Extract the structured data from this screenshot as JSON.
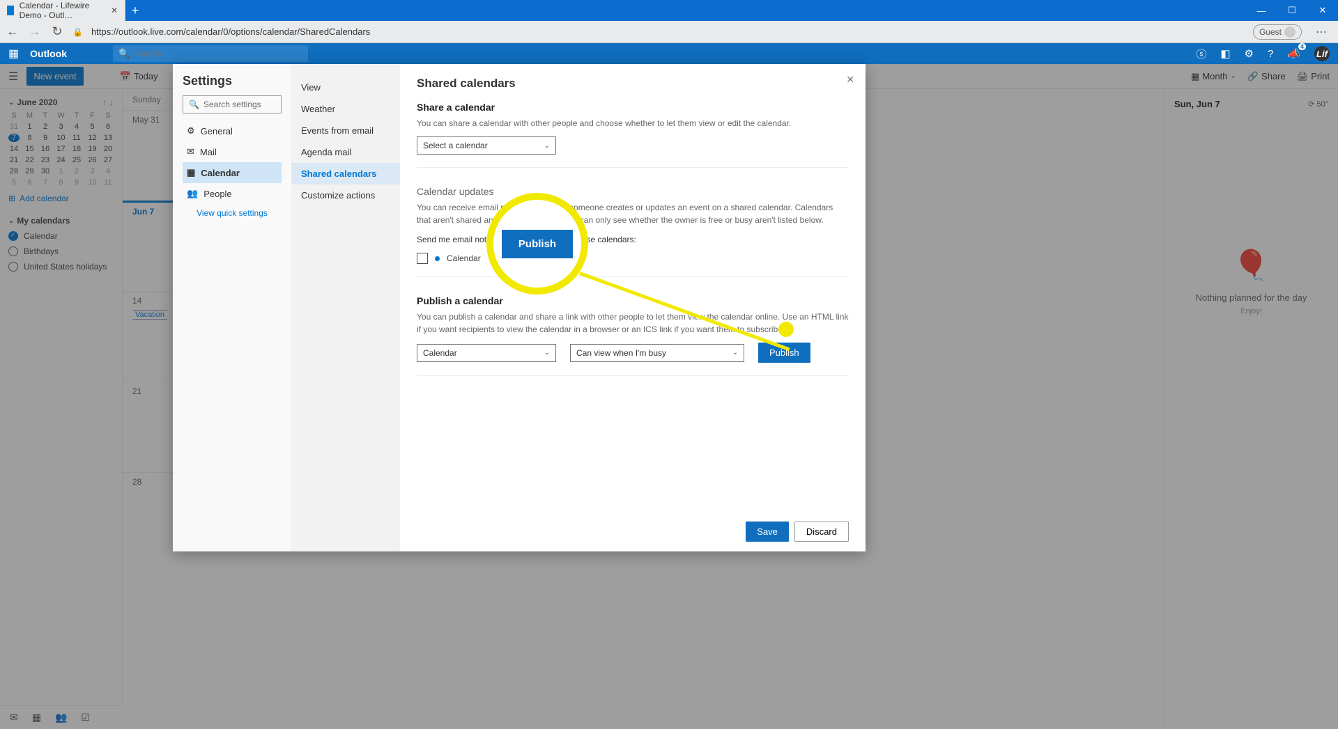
{
  "browser": {
    "tab_title": "Calendar - Lifewire Demo - Outl…",
    "url": "https://outlook.live.com/calendar/0/options/calendar/SharedCalendars",
    "guest_label": "Guest"
  },
  "appbar": {
    "app_name": "Outlook",
    "search_placeholder": "Search",
    "notif_badge": "4"
  },
  "toolbar": {
    "new_event": "New event",
    "today": "Today",
    "month": "Month",
    "share": "Share",
    "print": "Print"
  },
  "sidebar": {
    "month_label": "June 2020",
    "dow": [
      "S",
      "M",
      "T",
      "W",
      "T",
      "F",
      "S"
    ],
    "weeks": [
      [
        "31",
        "1",
        "2",
        "3",
        "4",
        "5",
        "6"
      ],
      [
        "7",
        "8",
        "9",
        "10",
        "11",
        "12",
        "13"
      ],
      [
        "14",
        "15",
        "16",
        "17",
        "18",
        "19",
        "20"
      ],
      [
        "21",
        "22",
        "23",
        "24",
        "25",
        "26",
        "27"
      ],
      [
        "28",
        "29",
        "30",
        "1",
        "2",
        "3",
        "4"
      ],
      [
        "5",
        "6",
        "7",
        "8",
        "9",
        "10",
        "11"
      ]
    ],
    "add_calendar": "Add calendar",
    "my_calendars": "My calendars",
    "cals": {
      "calendar": "Calendar",
      "birthdays": "Birthdays",
      "holidays": "United States holidays"
    }
  },
  "grid": {
    "dow_label": "Sunday",
    "cells": {
      "may31": "May 31",
      "jun7": "Jun 7",
      "d14": "14",
      "d21": "21",
      "d28": "28"
    },
    "vacation": "Vacation"
  },
  "rightpane": {
    "date": "Sun, Jun 7",
    "temp": "⟳ 50°",
    "nothing": "Nothing planned for the day",
    "enjoy": "Enjoy!"
  },
  "settings": {
    "title": "Settings",
    "search_placeholder": "Search settings",
    "nav": {
      "general": "General",
      "mail": "Mail",
      "calendar": "Calendar",
      "people": "People"
    },
    "quick": "View quick settings",
    "sub": {
      "view": "View",
      "weather": "Weather",
      "events": "Events from email",
      "agenda": "Agenda mail",
      "shared": "Shared calendars",
      "customize": "Customize actions"
    }
  },
  "shared": {
    "title": "Shared calendars",
    "share_title": "Share a calendar",
    "share_desc": "You can share a calendar with other people and choose whether to let them view or edit the calendar.",
    "share_select": "Select a calendar",
    "updates_title": "Calendar updates",
    "updates_desc": "You can receive email notifications when someone creates or updates an event on a shared calendar. Calendars that aren't shared and calendars where you can only see whether the owner is free or busy aren't listed below.",
    "updates_send": "Send me email notifications for updates to these calendars:",
    "updates_cal": "Calendar",
    "publish_title": "Publish a calendar",
    "publish_desc": "You can publish a calendar and share a link with other people to let them view the calendar online. Use an HTML link if you want recipients to view the calendar in a browser or an ICS link if you want them to subscribe.",
    "publish_cal_sel": "Calendar",
    "publish_perm_sel": "Can view when I'm busy",
    "publish_btn": "Publish",
    "save": "Save",
    "discard": "Discard"
  },
  "highlight": {
    "label": "Publish"
  }
}
